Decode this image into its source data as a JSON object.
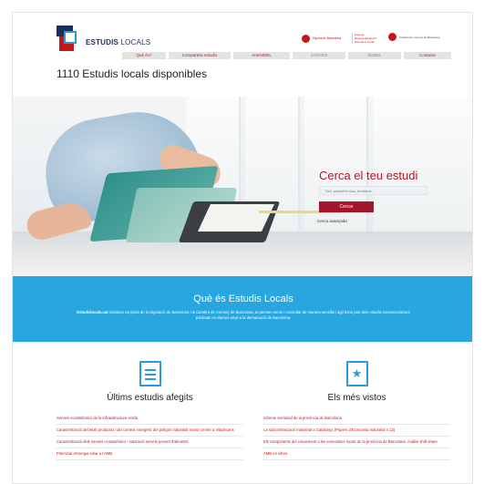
{
  "brand": {
    "name_bold": "ESTUDIS",
    "name_light": "LOCALS",
    "accent": "#c4161c",
    "navy": "#1a2f5a",
    "blue": "#2b9bd6"
  },
  "partners": {
    "diputacio": {
      "line1": "Diputació Barcelona",
      "line2": "Àrea de Desenvolupament Econòmic Local"
    },
    "cambra": {
      "label": "Cambra de Comerç de Barcelona"
    }
  },
  "nav": [
    {
      "label": "Què és?",
      "muted": false
    },
    {
      "label": "Comparteix estudis",
      "muted": false
    },
    {
      "label": "Arees/DEL",
      "muted": false
    },
    {
      "label": "XARXES",
      "muted": true
    },
    {
      "label": "SODEL",
      "muted": true
    },
    {
      "label": "Contacte",
      "muted": false
    }
  ],
  "count_title": "1110 Estudis locals disponibles",
  "search": {
    "title": "Cerca el teu estudi",
    "placeholder": "Títol, paraules clau, temàtica...",
    "button": "Cercar",
    "advanced": "Cerca avançada"
  },
  "about": {
    "title": "Què és Estudis Locals",
    "text_bold": "Estudislocals.cat",
    "text": " iniciativa conjunta de la Diputació de Barcelona i la Cambra de Comerç de Barcelona, et permet cercar i consultar de manera senzilla i àgil bona part dels estudis socioeconòmics publicats en darrers anys a la demarcació de Barcelona."
  },
  "latest": {
    "title": "Últims estudis afegits",
    "icon": "document-icon",
    "items": [
      "Serveis ecosistèmics de la infraestructura verda",
      "Caracterització del teixit productiu i del context energètic del polígon industrial sector centre a Viladecans",
      "Caracterització dels serveis ecosistèmics i valoració serveis proveït d'aliments",
      "Potencial d'energia solar a l'AMB"
    ]
  },
  "popular": {
    "title": "Els més vistos",
    "icon": "star-icon",
    "items": [
      "Informe territorial de la província de Barcelona",
      "La subcontractació industrial a Catalunya (Papers d'Economia Industrial n 13)",
      "Els components del creixement a les economies locals de la província de Barcelona. Anàlisi shift-share",
      "AMB en xifres"
    ]
  }
}
